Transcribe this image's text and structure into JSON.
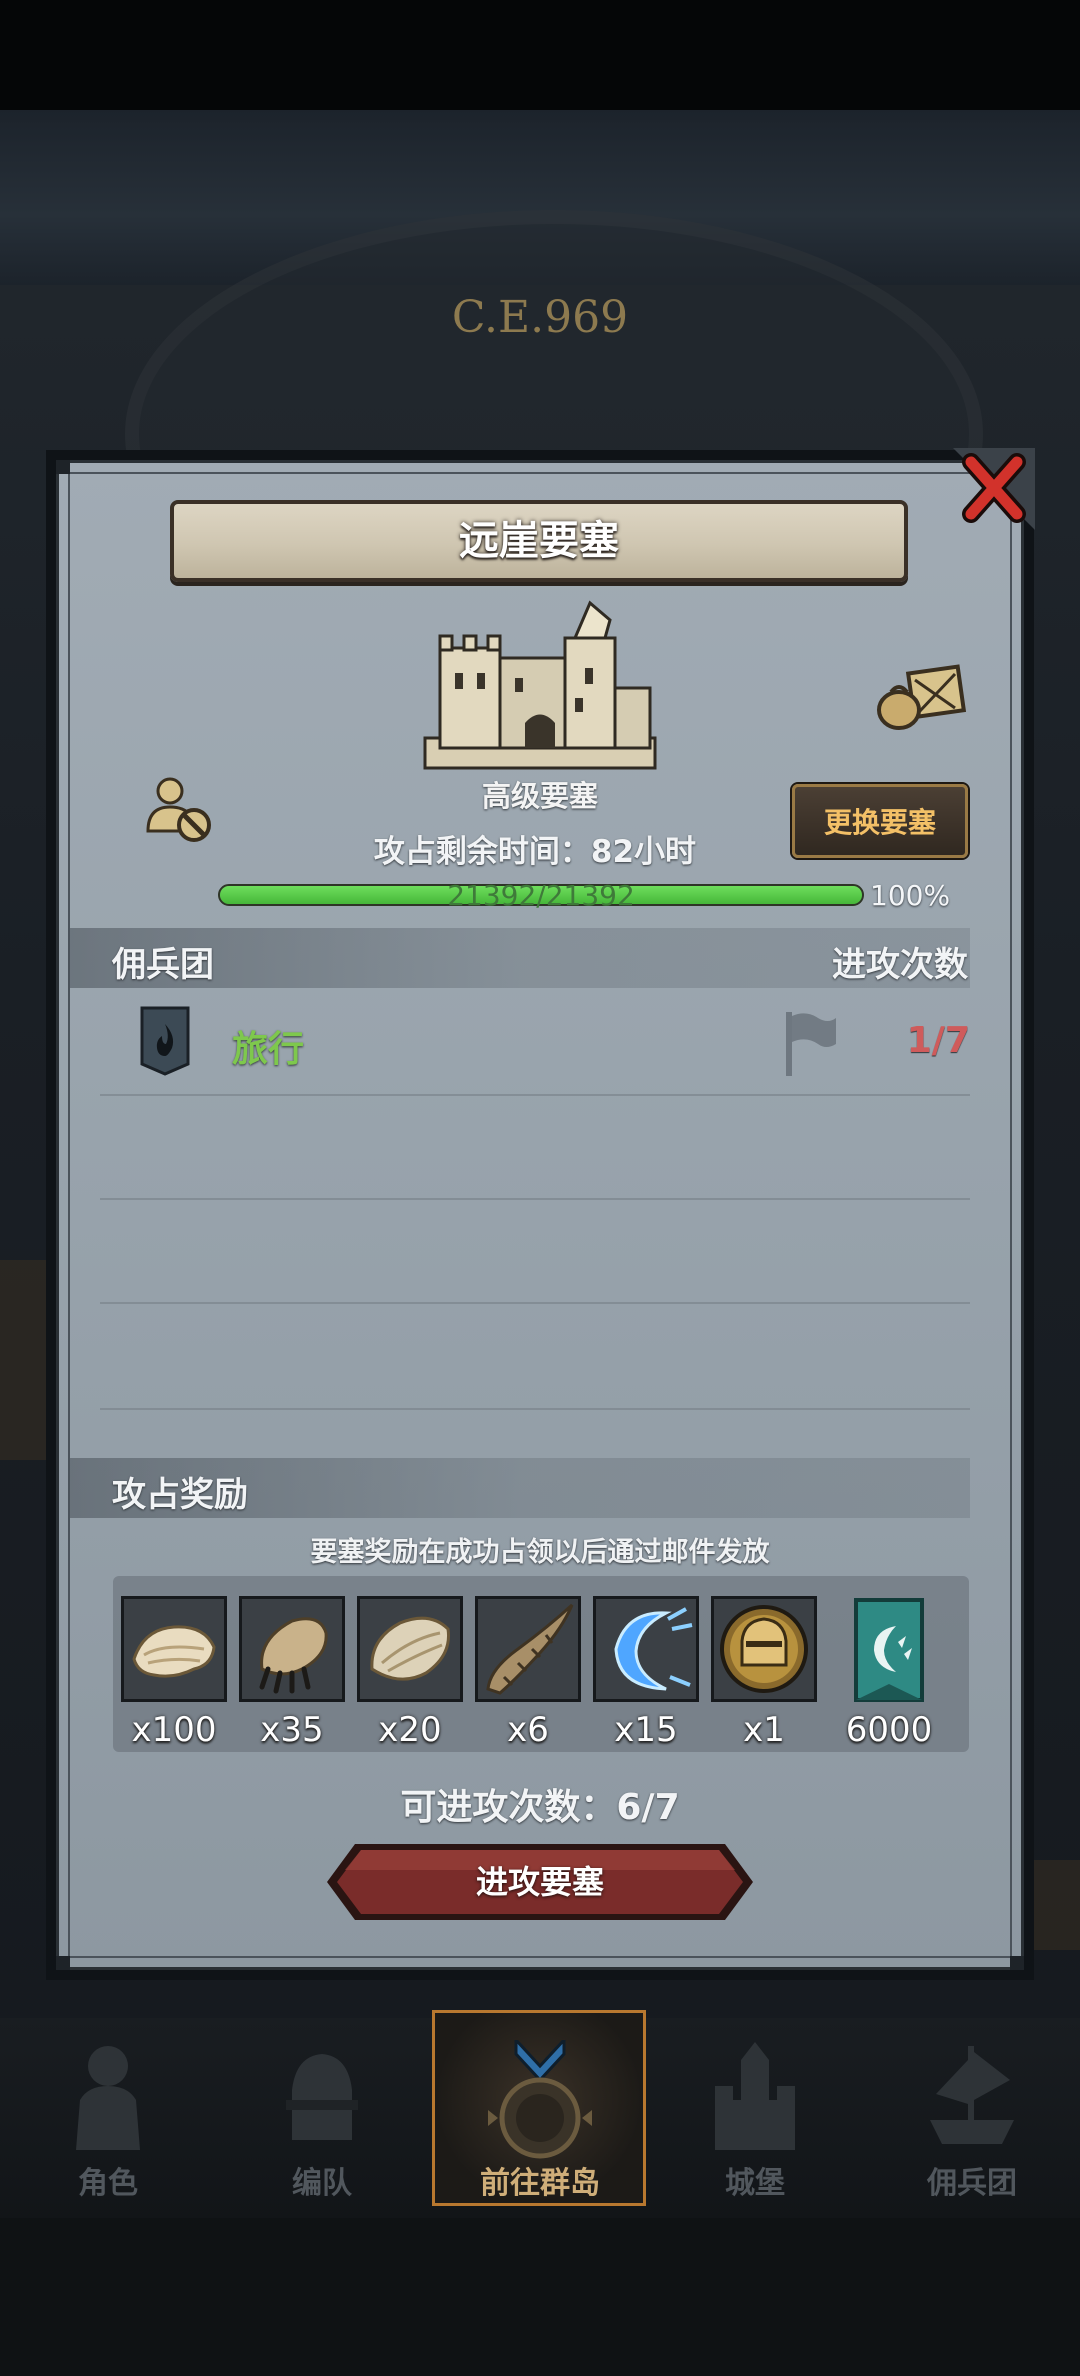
{
  "scene": {
    "era_label": "C.E.969"
  },
  "dialog": {
    "title": "远崖要塞",
    "fortress_rank": "高级要塞",
    "change_button": "更换要塞",
    "occupy_time": "攻占剩余时间：82小时",
    "hp": {
      "text": "21392/21392",
      "percent_label": "100%",
      "fraction": 1.0
    },
    "guild_section": {
      "left_label": "佣兵团",
      "right_label": "进攻次数"
    },
    "guild_rows": [
      {
        "name": "旅行",
        "attacks": "1/7"
      }
    ],
    "rewards_section": {
      "label": "攻占奖励",
      "note": "要塞奖励在成功占领以后通过邮件发放",
      "items": [
        {
          "icon": "fur-pelt-icon",
          "qty": "x100"
        },
        {
          "icon": "claw-paw-icon",
          "qty": "x35"
        },
        {
          "icon": "hide-leather-icon",
          "qty": "x20"
        },
        {
          "icon": "horn-icon",
          "qty": "x6"
        },
        {
          "icon": "blue-crescent-icon",
          "qty": "x15"
        },
        {
          "icon": "knight-helmet-medal-icon",
          "qty": "x1"
        },
        {
          "icon": "guild-banner-icon",
          "qty": "6000"
        }
      ]
    },
    "remaining_attacks": "可进攻次数：6/7",
    "attack_button": "进攻要塞"
  },
  "nav": {
    "items": [
      {
        "label": "角色",
        "icon": "character-knight-icon"
      },
      {
        "label": "编队",
        "icon": "formation-helmet-icon"
      },
      {
        "label": "前往群岛",
        "icon": "islands-compass-icon",
        "active": true
      },
      {
        "label": "城堡",
        "icon": "castle-icon"
      },
      {
        "label": "佣兵团",
        "icon": "mercenary-ship-icon"
      }
    ]
  },
  "colors": {
    "accent_gold": "#f3c067",
    "guild_green": "#7ec84d",
    "attack_red": "#cf5b5b",
    "hp_green": "#46b73a",
    "attack_button": "#7a2c2a"
  }
}
